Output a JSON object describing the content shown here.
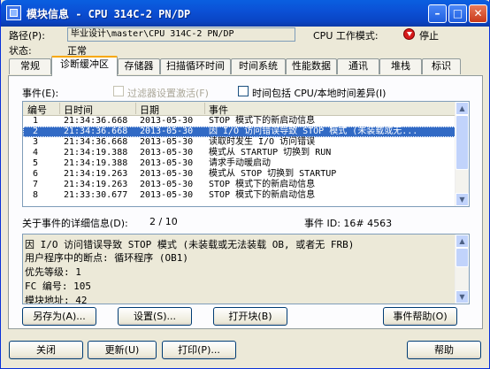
{
  "window": {
    "title": "模块信息 - CPU 314C-2 PN/DP"
  },
  "titlebar_buttons": [
    "minimize",
    "maximize",
    "close"
  ],
  "header": {
    "path_label": "路径(P):",
    "path_value": "毕业设计\\master\\CPU 314C-2 PN/DP",
    "status_label": "状态:",
    "status_value": "正常",
    "cpu_mode_label": "CPU 工作模式:",
    "cpu_mode_value": "停止"
  },
  "tabs": [
    "常规",
    "诊断缓冲区",
    "存储器",
    "扫描循环时间",
    "时间系统",
    "性能数据",
    "通讯",
    "堆栈",
    "标识"
  ],
  "active_tab": "诊断缓冲区",
  "events": {
    "label": "事件(E):",
    "filter_label": "过滤器设置激活(F)",
    "time_option_label": "时间包括 CPU/本地时间差异(I)",
    "columns": [
      "编号",
      "日时间",
      "日期",
      "事件"
    ],
    "rows": [
      {
        "no": "1",
        "time": "21:34:36.668",
        "date": "2013-05-30",
        "event": "STOP 模式下的新启动信息"
      },
      {
        "no": "2",
        "time": "21:34:36.668",
        "date": "2013-05-30",
        "event": "因 I/O 访问错误导致 STOP 模式 (未装载或无..."
      },
      {
        "no": "3",
        "time": "21:34:36.668",
        "date": "2013-05-30",
        "event": "读取时发生 I/O 访问错误"
      },
      {
        "no": "4",
        "time": "21:34:19.388",
        "date": "2013-05-30",
        "event": "模式从 STARTUP 切换到 RUN"
      },
      {
        "no": "5",
        "time": "21:34:19.388",
        "date": "2013-05-30",
        "event": "请求手动暖启动"
      },
      {
        "no": "6",
        "time": "21:34:19.263",
        "date": "2013-05-30",
        "event": "模式从 STOP 切换到 STARTUP"
      },
      {
        "no": "7",
        "time": "21:34:19.263",
        "date": "2013-05-30",
        "event": "STOP 模式下的新启动信息"
      },
      {
        "no": "8",
        "time": "21:33:30.677",
        "date": "2013-05-30",
        "event": "STOP 模式下的新启动信息"
      }
    ],
    "selected_row": 1
  },
  "details": {
    "label": "关于事件的详细信息(D):",
    "counter": "2 / 10",
    "event_id": "事件 ID: 16# 4563",
    "lines": [
      "因 I/O 访问错误导致 STOP 模式 (未装载或无法装载 OB, 或者无 FRB)",
      "用户程序中的断点: 循环程序 (OB1)",
      "优先等级:    1",
      "FC 编号:     105",
      "模块地址:    42"
    ]
  },
  "panel_buttons": {
    "save_as": "另存为(A)...",
    "settings": "设置(S)...",
    "open_block": "打开块(B)",
    "event_help": "事件帮助(O)"
  },
  "footer_buttons": {
    "close": "关闭",
    "update": "更新(U)",
    "print": "打印(P)...",
    "help": "帮助"
  }
}
